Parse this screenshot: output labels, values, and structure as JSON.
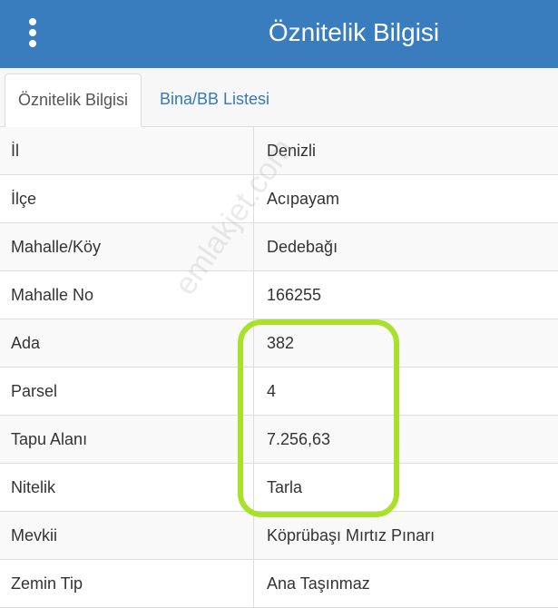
{
  "header": {
    "title": "Öznitelik Bilgisi",
    "menu_icon": "vertical-dots-icon",
    "background_color": "#3a7dbf"
  },
  "tabs": [
    {
      "label": "Öznitelik Bilgisi",
      "active": true
    },
    {
      "label": "Bina/BB Listesi",
      "active": false
    }
  ],
  "attributes": [
    {
      "label": "İl",
      "value": "Denizli"
    },
    {
      "label": "İlçe",
      "value": "Acıpayam"
    },
    {
      "label": "Mahalle/Köy",
      "value": "Dedebağı"
    },
    {
      "label": "Mahalle No",
      "value": "166255"
    },
    {
      "label": "Ada",
      "value": "382"
    },
    {
      "label": "Parsel",
      "value": "4"
    },
    {
      "label": "Tapu Alanı",
      "value": "7.256,63"
    },
    {
      "label": "Nitelik",
      "value": "Tarla"
    },
    {
      "label": "Mevkii",
      "value": "Köprübaşı Mırtız Pınarı"
    },
    {
      "label": "Zemin Tip",
      "value": "Ana Taşınmaz"
    }
  ],
  "watermark": "emlakjet.com",
  "highlight_color": "#a8e02a"
}
